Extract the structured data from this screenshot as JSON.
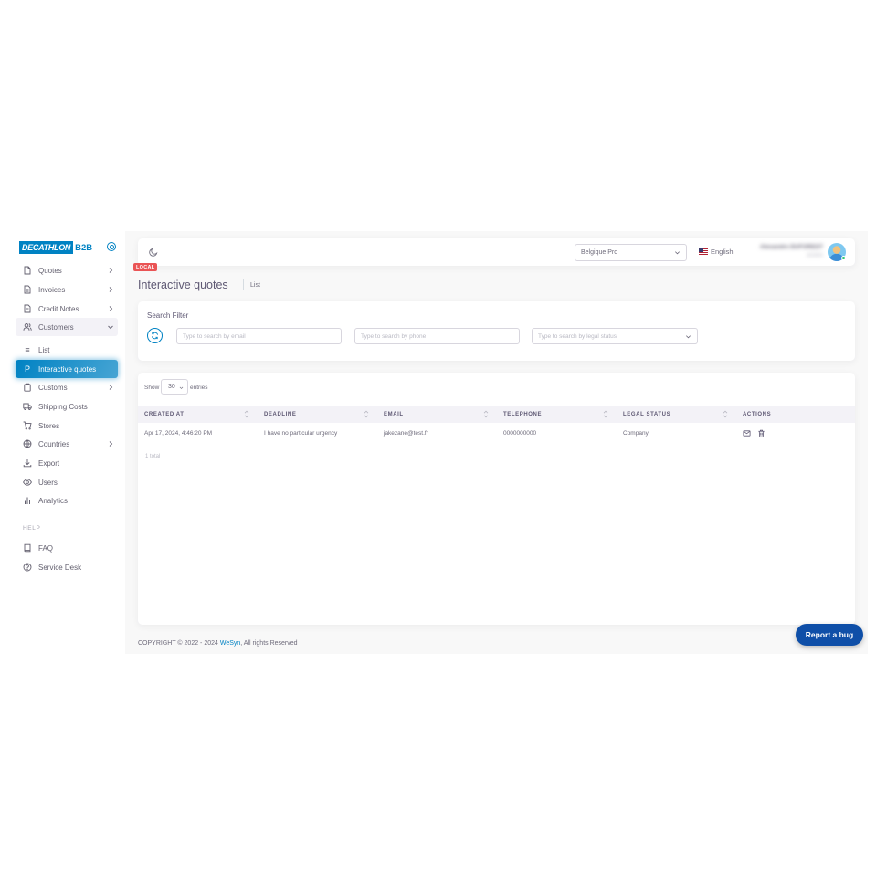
{
  "brand": {
    "logo": "DECATHLON",
    "suffix": "B2B"
  },
  "sidebar": {
    "items": [
      {
        "label": "Quotes",
        "icon": "file-icon",
        "has_children": true
      },
      {
        "label": "Invoices",
        "icon": "file-text-icon",
        "has_children": true
      },
      {
        "label": "Credit Notes",
        "icon": "file-icon",
        "has_children": true
      },
      {
        "label": "Customers",
        "icon": "users-icon",
        "has_children": true,
        "expanded": true
      },
      {
        "label": "List",
        "icon": "list-icon",
        "sub": true
      },
      {
        "label": "Interactive quotes",
        "icon": "p-icon",
        "sub": true,
        "active": true
      },
      {
        "label": "Customs",
        "icon": "clipboard-icon",
        "has_children": true
      },
      {
        "label": "Shipping Costs",
        "icon": "truck-icon"
      },
      {
        "label": "Stores",
        "icon": "cart-icon"
      },
      {
        "label": "Countries",
        "icon": "globe-icon",
        "has_children": true
      },
      {
        "label": "Export",
        "icon": "download-icon"
      },
      {
        "label": "Users",
        "icon": "eye-icon"
      },
      {
        "label": "Analytics",
        "icon": "bar-chart-icon"
      }
    ],
    "help_label": "HELP",
    "help_items": [
      {
        "label": "FAQ",
        "icon": "book-icon"
      },
      {
        "label": "Service Desk",
        "icon": "help-circle-icon"
      }
    ]
  },
  "navbar": {
    "store_select": "Belgique Pro",
    "language": "English",
    "user_name": "Alexandre DUFOREST",
    "user_role": "ADMIN"
  },
  "badge": "LOCAL",
  "page": {
    "title": "Interactive quotes",
    "breadcrumb": "List"
  },
  "filter": {
    "title": "Search Filter",
    "email_placeholder": "Type to search by email",
    "phone_placeholder": "Type to search by phone",
    "legal_placeholder": "Type to search by legal status"
  },
  "table": {
    "show_label": "Show",
    "page_length": "30",
    "entries_label": "entries",
    "columns": [
      "CREATED AT",
      "DEADLINE",
      "EMAIL",
      "TELEPHONE",
      "LEGAL STATUS",
      "ACTIONS"
    ],
    "rows": [
      {
        "created_at": "Apr 17, 2024, 4:46:20 PM",
        "deadline": "I have no particular urgency",
        "email": "jakezane@test.fr",
        "telephone": "0000000000",
        "legal_status": "Company"
      }
    ],
    "total": "1 total"
  },
  "footer": {
    "copyright": "COPYRIGHT © 2022 - 2024",
    "link": "WeSyn",
    "rights": ", All rights Reserved"
  },
  "report_button": "Report a bug",
  "colors": {
    "accent": "#0082c3",
    "badge": "#ea5455",
    "report": "#0f4fa8"
  }
}
